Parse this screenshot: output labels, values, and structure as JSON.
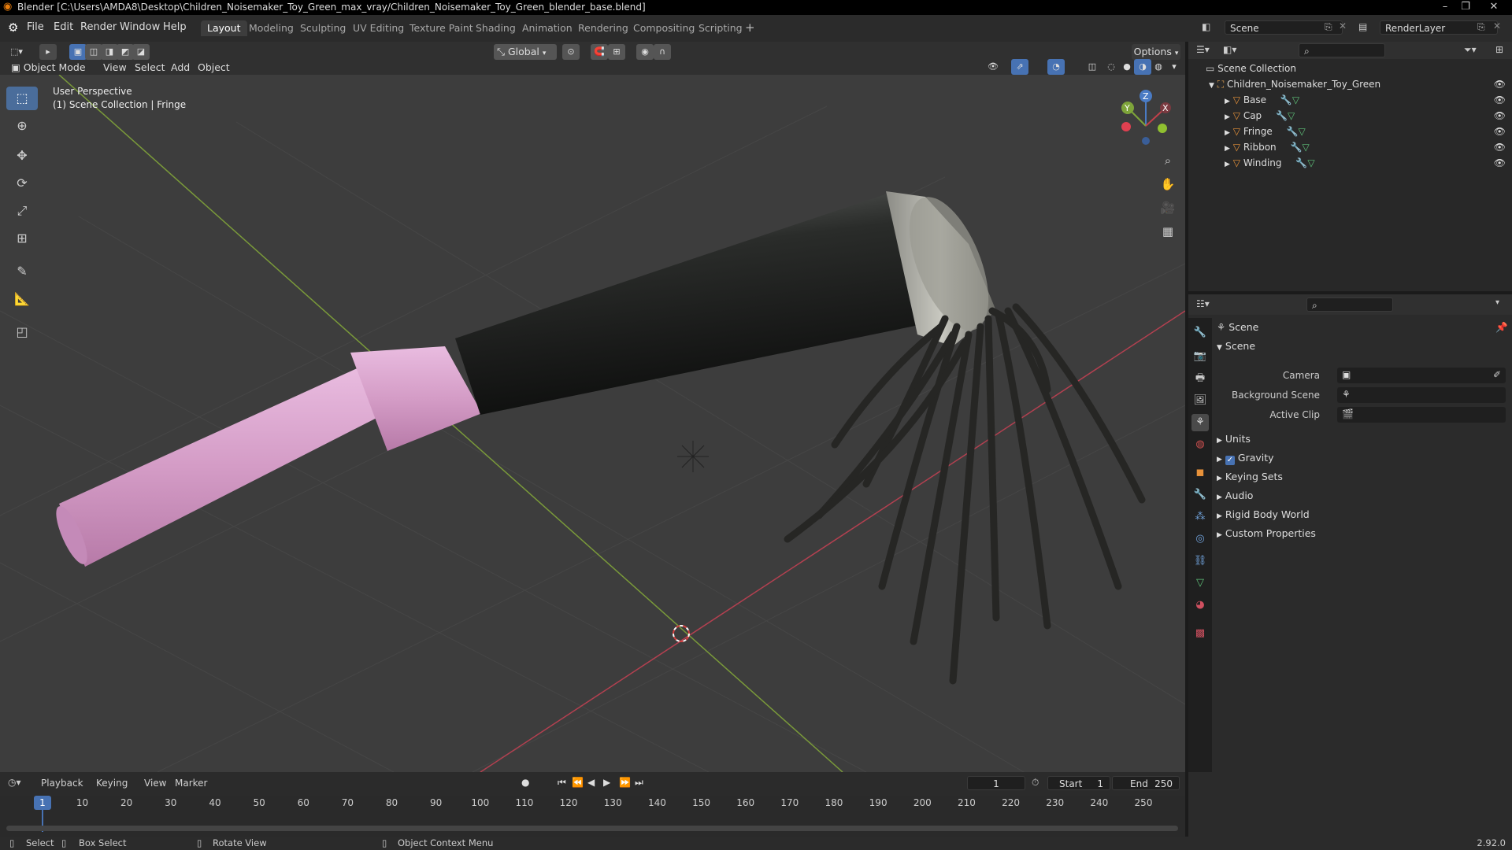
{
  "titlebar": {
    "title": "Blender [C:\\Users\\AMDA8\\Desktop\\Children_Noisemaker_Toy_Green_max_vray/Children_Noisemaker_Toy_Green_blender_base.blend]"
  },
  "menu": [
    "File",
    "Edit",
    "Render",
    "Window",
    "Help"
  ],
  "workspaces": [
    "Layout",
    "Modeling",
    "Sculpting",
    "UV Editing",
    "Texture Paint",
    "Shading",
    "Animation",
    "Rendering",
    "Compositing",
    "Scripting"
  ],
  "active_workspace": "Layout",
  "scene_field": "Scene",
  "renderlayer_field": "RenderLayer",
  "viewport": {
    "transform_orientation": "Global",
    "options_label": "Options",
    "mode": "Object Mode",
    "header_menus": [
      "View",
      "Select",
      "Add",
      "Object"
    ],
    "overlay_title": "User Perspective",
    "overlay_subtitle": "(1) Scene Collection | Fringe",
    "gizmo_axes": {
      "x": "X",
      "y": "Y",
      "z": "Z"
    }
  },
  "outliner": {
    "root": "Scene Collection",
    "collection": "Children_Noisemaker_Toy_Green",
    "objects": [
      "Base",
      "Cap",
      "Fringe",
      "Ribbon",
      "Winding"
    ]
  },
  "properties": {
    "context": "Scene",
    "panel": "Scene",
    "fields": [
      {
        "label": "Camera"
      },
      {
        "label": "Background Scene"
      },
      {
        "label": "Active Clip"
      }
    ],
    "sections": [
      "Units",
      "Gravity",
      "Keying Sets",
      "Audio",
      "Rigid Body World",
      "Custom Properties"
    ],
    "gravity_checked": true
  },
  "timeline": {
    "menus": [
      "Playback",
      "Keying",
      "View",
      "Marker"
    ],
    "current_frame": "1",
    "start_label": "Start",
    "start": "1",
    "end_label": "End",
    "end": "250",
    "ticks": [
      "1",
      "10",
      "20",
      "30",
      "40",
      "50",
      "60",
      "70",
      "80",
      "90",
      "100",
      "110",
      "120",
      "130",
      "140",
      "150",
      "160",
      "170",
      "180",
      "190",
      "200",
      "210",
      "220",
      "230",
      "240",
      "250"
    ]
  },
  "statusbar": {
    "select": "Select",
    "box_select": "Box Select",
    "rotate": "Rotate View",
    "context_menu": "Object Context Menu",
    "version": "2.92.0"
  },
  "colors": {
    "accent": "#4772b3",
    "pink_tube": "#d9a1c9",
    "x_axis": "#c0404a",
    "y_axis": "#7ea43a"
  }
}
